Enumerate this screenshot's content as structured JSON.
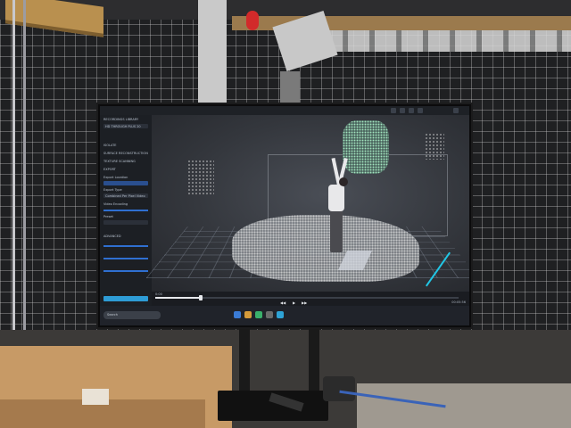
{
  "scene": {
    "description_colors": {
      "wall": "#1f2022",
      "cardboard": "#c79a66",
      "screen_accent": "#2e9cd6",
      "pointcloud_green": "#4f6b63"
    }
  },
  "app": {
    "title": "",
    "sidebar": {
      "sections": [
        {
          "label": "RECORDINGS LIBRARY"
        },
        {
          "label": "HD THROUGH PLUS 20"
        },
        {
          "label": "ISOLATE"
        },
        {
          "label": "SURFACE RECONSTRUCTION"
        },
        {
          "label": "TEXTURE SCANNING"
        },
        {
          "label": "EXPORT"
        },
        {
          "label": "Export Location"
        },
        {
          "label": "Export Type"
        },
        {
          "label": "Combined Per Pixel Video"
        },
        {
          "label": "Video Encoding"
        },
        {
          "label": "Preset"
        },
        {
          "label": "ADVANCED"
        }
      ],
      "export_button": ""
    },
    "timeline": {
      "label": "0:00",
      "progress": 0.15,
      "time": "00:05:56"
    },
    "taskbar": {
      "search_placeholder": "Search",
      "weather": "",
      "clock": ""
    }
  }
}
